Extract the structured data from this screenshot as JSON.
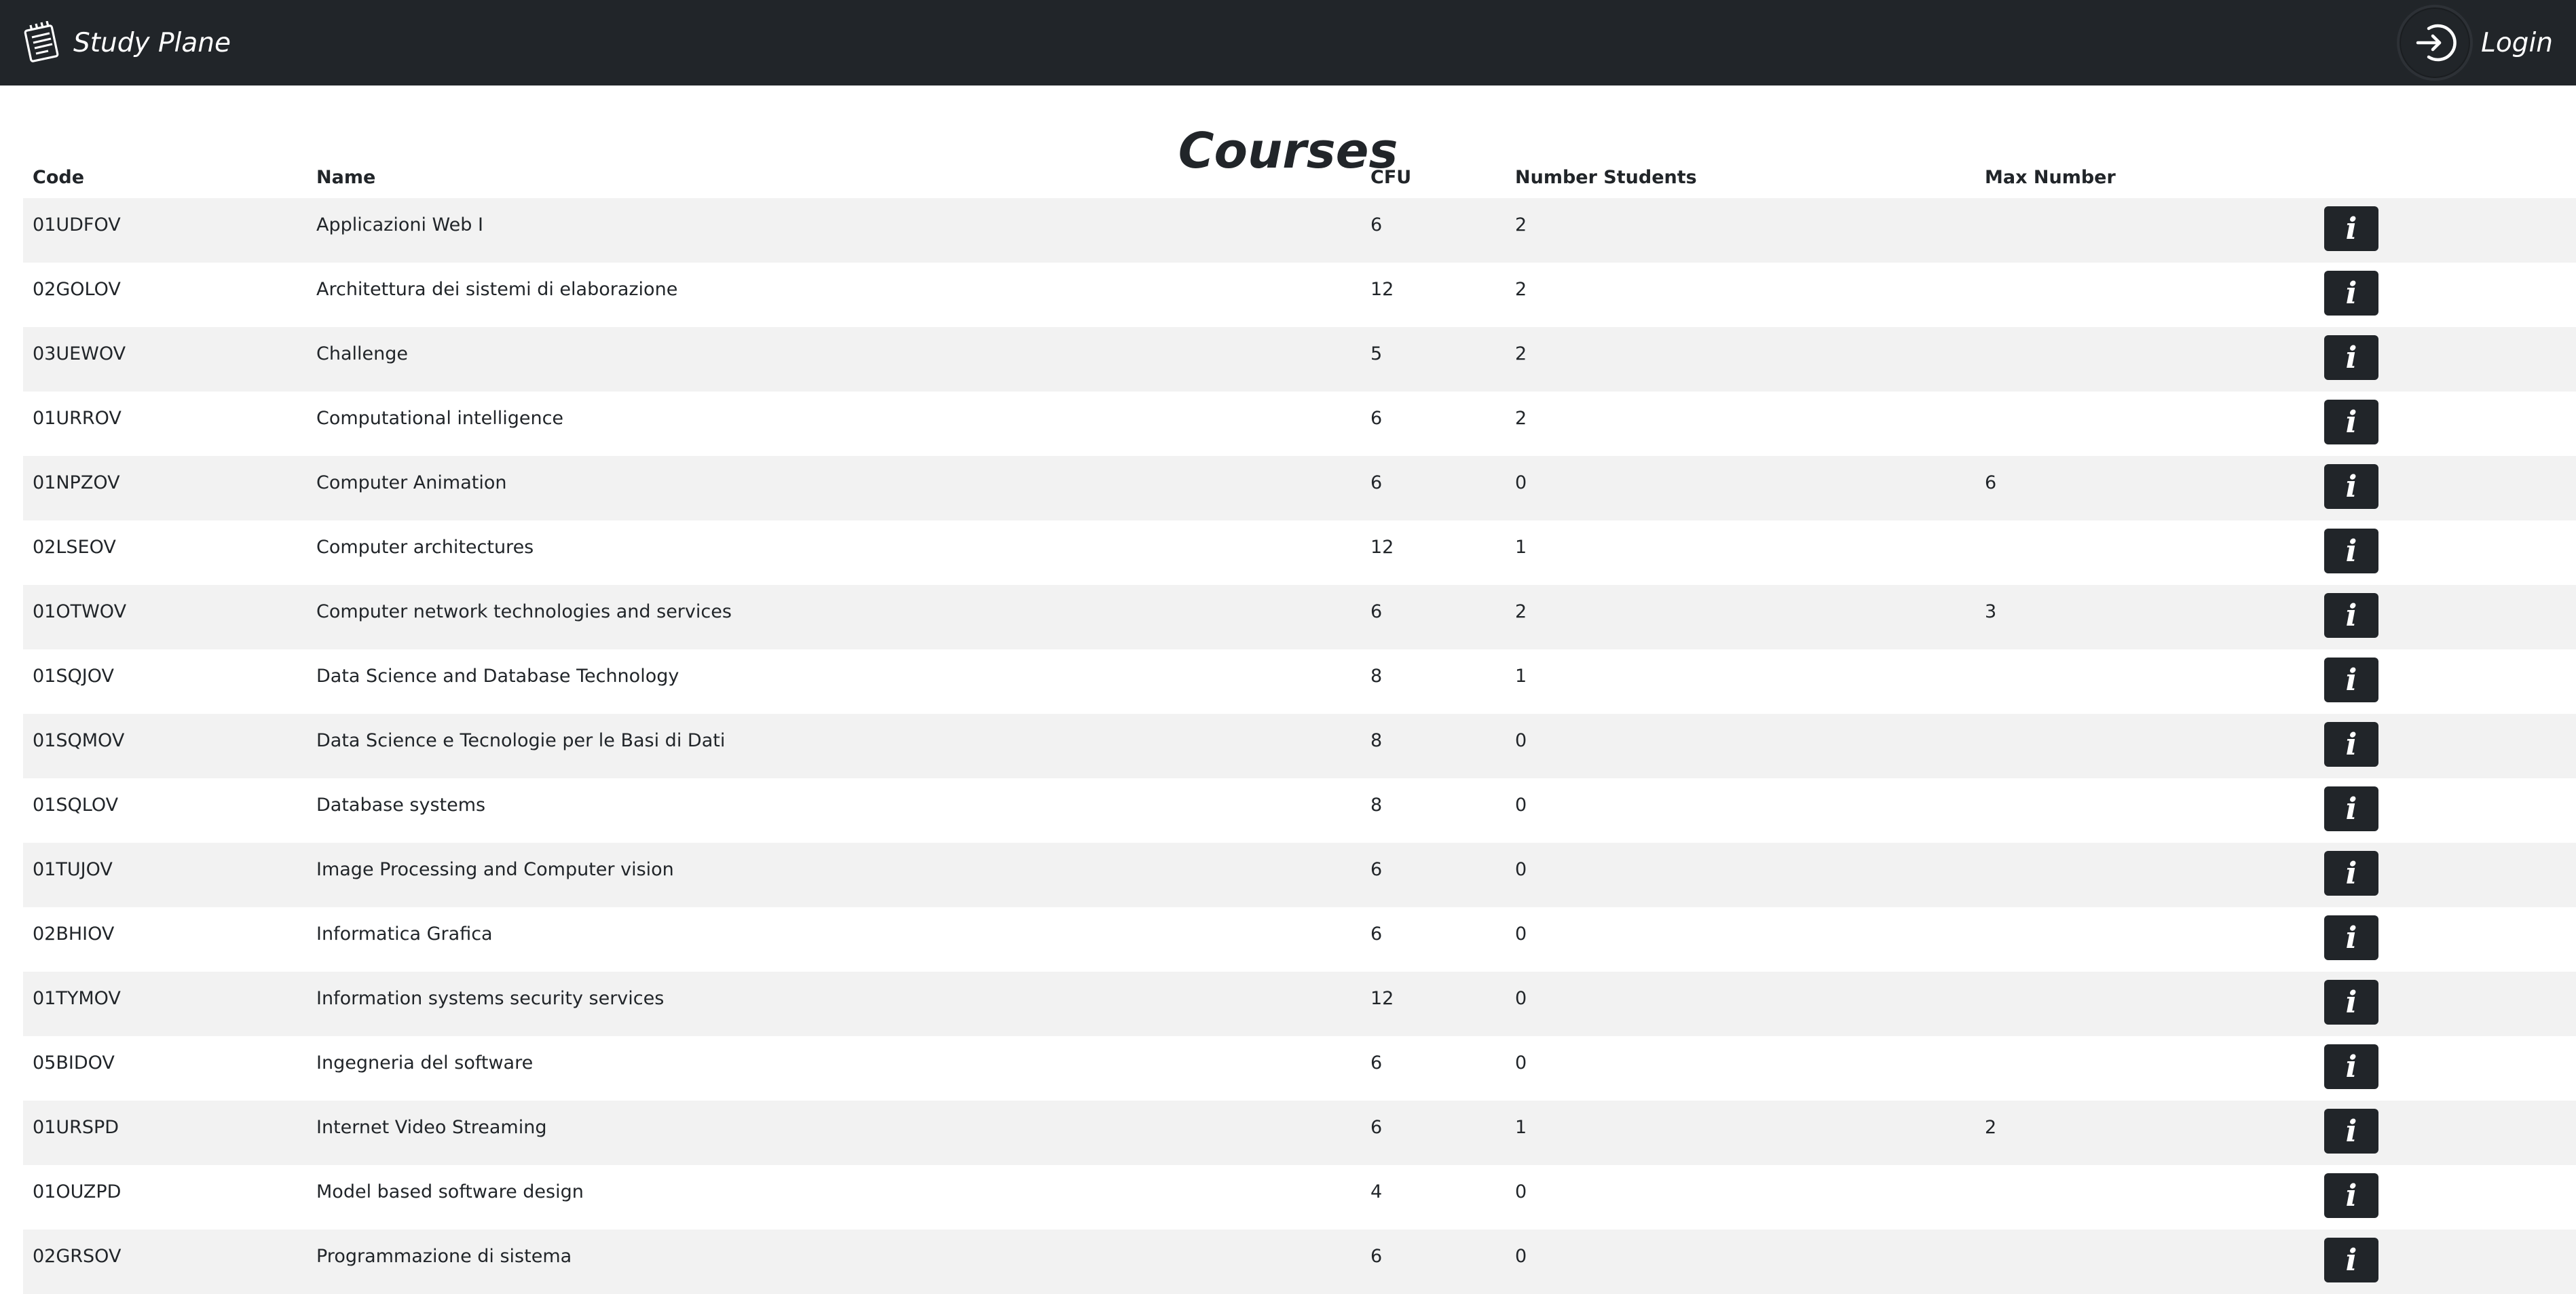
{
  "navbar": {
    "brand_label": "Study Plane",
    "brand_icon": "notepad-icon",
    "login_label": "Login",
    "login_icon": "login-arrow-icon"
  },
  "page_title": "Courses",
  "table": {
    "columns": [
      "Code",
      "Name",
      "CFU",
      "Number Students",
      "Max Number",
      ""
    ],
    "info_button_glyph": "i",
    "rows": [
      {
        "code": "01UDFOV",
        "name": "Applicazioni Web I",
        "cfu": "6",
        "students": "2",
        "max": ""
      },
      {
        "code": "02GOLOV",
        "name": "Architettura dei sistemi di elaborazione",
        "cfu": "12",
        "students": "2",
        "max": ""
      },
      {
        "code": "03UEWOV",
        "name": "Challenge",
        "cfu": "5",
        "students": "2",
        "max": ""
      },
      {
        "code": "01URROV",
        "name": "Computational intelligence",
        "cfu": "6",
        "students": "2",
        "max": ""
      },
      {
        "code": "01NPZOV",
        "name": "Computer Animation",
        "cfu": "6",
        "students": "0",
        "max": "6"
      },
      {
        "code": "02LSEOV",
        "name": "Computer architectures",
        "cfu": "12",
        "students": "1",
        "max": ""
      },
      {
        "code": "01OTWOV",
        "name": "Computer network technologies and services",
        "cfu": "6",
        "students": "2",
        "max": "3"
      },
      {
        "code": "01SQJOV",
        "name": "Data Science and Database Technology",
        "cfu": "8",
        "students": "1",
        "max": ""
      },
      {
        "code": "01SQMOV",
        "name": "Data Science e Tecnologie per le Basi di Dati",
        "cfu": "8",
        "students": "0",
        "max": ""
      },
      {
        "code": "01SQLOV",
        "name": "Database systems",
        "cfu": "8",
        "students": "0",
        "max": ""
      },
      {
        "code": "01TUJOV",
        "name": "Image Processing and Computer vision",
        "cfu": "6",
        "students": "0",
        "max": ""
      },
      {
        "code": "02BHIOV",
        "name": "Informatica Grafica",
        "cfu": "6",
        "students": "0",
        "max": ""
      },
      {
        "code": "01TYMOV",
        "name": "Information systems security services",
        "cfu": "12",
        "students": "0",
        "max": ""
      },
      {
        "code": "05BIDOV",
        "name": "Ingegneria del software",
        "cfu": "6",
        "students": "0",
        "max": ""
      },
      {
        "code": "01URSPD",
        "name": "Internet Video Streaming",
        "cfu": "6",
        "students": "1",
        "max": "2"
      },
      {
        "code": "01OUZPD",
        "name": "Model based software design",
        "cfu": "4",
        "students": "0",
        "max": ""
      },
      {
        "code": "02GRSOV",
        "name": "Programmazione di sistema",
        "cfu": "6",
        "students": "0",
        "max": ""
      }
    ]
  },
  "colors": {
    "navbar_bg": "#212529",
    "stripe_bg": "#f2f2f2",
    "button_bg": "#212529"
  }
}
